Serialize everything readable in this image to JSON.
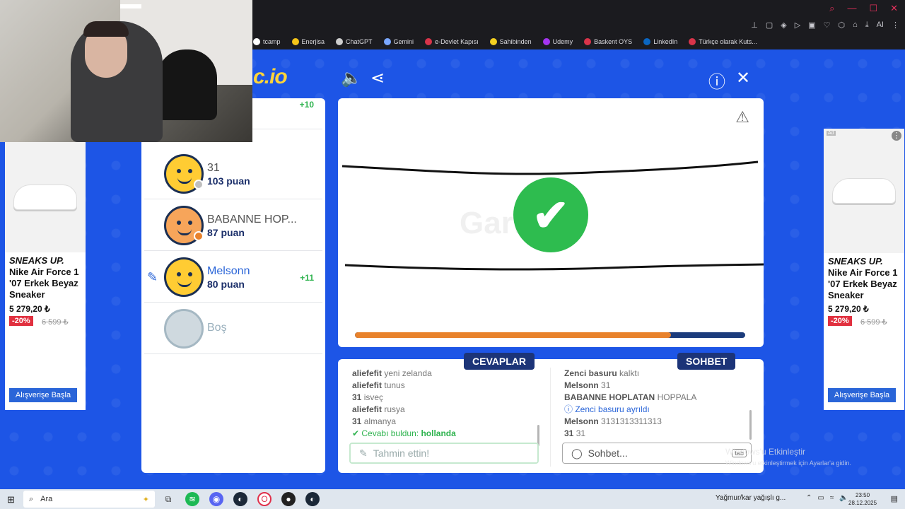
{
  "browser": {
    "bookmarks": [
      {
        "label": "tcamp",
        "color": "#ffffff"
      },
      {
        "label": "Enerjisa",
        "color": "#f5c518"
      },
      {
        "label": "ChatGPT",
        "color": "#cfcfcf"
      },
      {
        "label": "Gemini",
        "color": "#7aa7ff"
      },
      {
        "label": "e-Devlet Kapısı",
        "color": "#d9344a"
      },
      {
        "label": "Sahibinden",
        "color": "#f5d020"
      },
      {
        "label": "Udemy",
        "color": "#a435f0"
      },
      {
        "label": "Baskent OYS",
        "color": "#d9344a"
      },
      {
        "label": "LinkedIn",
        "color": "#0a66c2"
      },
      {
        "label": "Türkçe olarak Kuts...",
        "color": "#d9344a"
      }
    ]
  },
  "game": {
    "logo": "c.io",
    "sound_icon": "speaker-icon",
    "share_icon": "share-icon",
    "players": [
      {
        "name": "",
        "score": "",
        "delta": "+10",
        "tag": "bi",
        "avatar": "yellow",
        "status_color": "#2fb34f"
      },
      {
        "name": "31",
        "score": "103 puan",
        "delta": "",
        "avatar": "yellow",
        "status_color": "#bfbfbf"
      },
      {
        "name": "BABANNE HOP...",
        "score": "87 puan",
        "delta": "",
        "avatar": "bald",
        "status_color": "#e8822c"
      },
      {
        "name": "Melsonn",
        "score": "80 puan",
        "delta": "+11",
        "avatar": "yellow",
        "drawing": true
      },
      {
        "name": "Boş",
        "score": "",
        "delta": "",
        "avatar": "empty"
      }
    ],
    "canvas": {
      "watermark": "Gartic.io",
      "timer_progress": 0.81,
      "progress_color": "#e8822c",
      "result": "check-icon"
    },
    "answers": {
      "title": "CEVAPLAR",
      "lines": [
        {
          "user": "aliefefit",
          "text": "yeni zelanda"
        },
        {
          "user": "aliefefit",
          "text": "tunus"
        },
        {
          "user": "31",
          "text": "isveç"
        },
        {
          "user": "aliefefit",
          "text": "rusya"
        },
        {
          "user": "31",
          "text": "almanya"
        }
      ],
      "found_text": "Cevabı buldun:",
      "found_answer": "hollanda",
      "placeholder": "Tahmin ettin!"
    },
    "chat": {
      "title": "SOHBET",
      "lines": [
        {
          "user": "Zenci basuru",
          "text": "kalktı"
        },
        {
          "user": "Melsonn",
          "text": "31"
        },
        {
          "user": "BABANNE HOPLATAN",
          "text": "HOPPALA"
        },
        {
          "user": "",
          "text": "Zenci basuru ayrıldı",
          "info": true
        },
        {
          "user": "Melsonn",
          "text": "3131313311313"
        },
        {
          "user": "31",
          "text": "31"
        }
      ],
      "placeholder": "Sohbet...",
      "tab_hint": "tab"
    }
  },
  "ads": {
    "brand": "SNEAKS UP.",
    "title": "Nike Air Force 1 '07 Erkek Beyaz Sneaker",
    "price": "5 279,20 ₺",
    "discount": "-20%",
    "old_price": "6 599 ₺",
    "button": "Alışverişe Başla",
    "tag": "Ad"
  },
  "windows": {
    "activate_title": "Windows'u Etkinleştir",
    "activate_sub": "Windows'u etkinleştirmek için Ayarlar'a gidin.",
    "search_label": "Ara",
    "weather": "Yağmur/kar yağışlı g...",
    "time": "23:50",
    "date": "28.12.2025"
  }
}
